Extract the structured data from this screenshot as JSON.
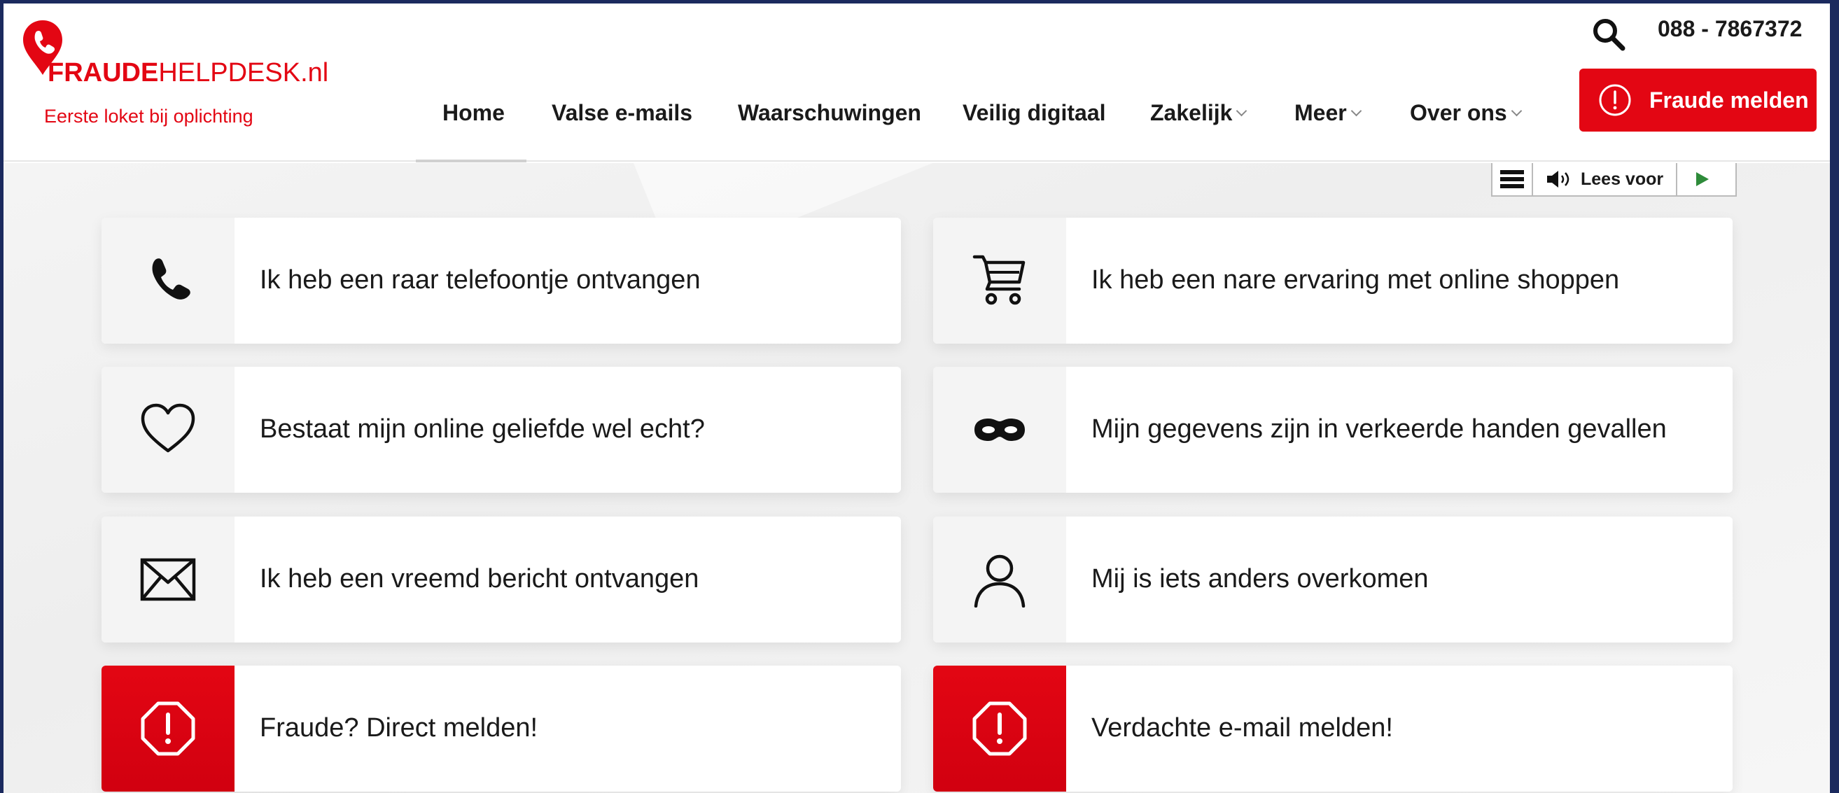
{
  "header": {
    "logo_strong": "FRAUDE",
    "logo_light": "HELPDESK.nl",
    "tagline": "Eerste loket bij oplichting",
    "phone": "088 - 7867372",
    "report_button": "Fraude melden",
    "nav": [
      {
        "label": "Home"
      },
      {
        "label": "Valse e-mails"
      },
      {
        "label": "Waarschuwingen"
      },
      {
        "label": "Veilig digitaal"
      },
      {
        "label": "Zakelijk"
      },
      {
        "label": "Meer"
      },
      {
        "label": "Over ons"
      }
    ]
  },
  "readspeaker": {
    "label": "Lees voor"
  },
  "cards": [
    {
      "label": "Ik heb een raar telefoontje ontvangen",
      "icon": "phone-icon"
    },
    {
      "label": "Ik heb een nare ervaring met online shoppen",
      "icon": "shopping-cart-icon"
    },
    {
      "label": "Bestaat mijn online geliefde wel echt?",
      "icon": "heart-icon"
    },
    {
      "label": "Mijn gegevens zijn in verkeerde handen gevallen",
      "icon": "mask-icon"
    },
    {
      "label": "Ik heb een vreemd bericht ontvangen",
      "icon": "envelope-icon"
    },
    {
      "label": "Mij is iets anders overkomen",
      "icon": "person-icon"
    },
    {
      "label": "Fraude? Direct melden!",
      "icon": "alert-octagon-icon"
    },
    {
      "label": "Verdachte e-mail melden!",
      "icon": "alert-octagon-icon"
    }
  ],
  "colors": {
    "brand_red": "#e30613",
    "frame": "#1b2a5e"
  }
}
